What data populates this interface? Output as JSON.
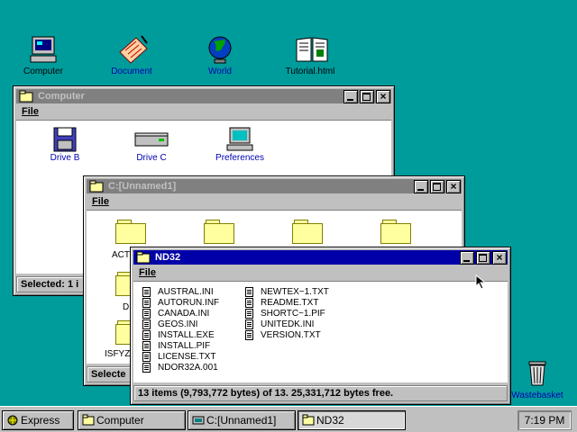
{
  "desktop": {
    "icons": [
      {
        "label": "Computer"
      },
      {
        "label": "Document"
      },
      {
        "label": "World"
      },
      {
        "label": "Tutorial.html"
      }
    ],
    "wastebasket": {
      "label": "Wastebasket"
    }
  },
  "windows": {
    "computer": {
      "title": "Computer",
      "menu": "File",
      "items": [
        {
          "label": "Drive B"
        },
        {
          "label": "Drive C"
        },
        {
          "label": "Preferences"
        }
      ],
      "status": "Selected: 1 i"
    },
    "unnamed": {
      "title": "C:[Unnamed1]",
      "menu": "File",
      "folders": [
        {
          "label": "ACT"
        },
        {
          "label": ""
        },
        {
          "label": ""
        },
        {
          "label": ""
        },
        {
          "label": "D"
        },
        {
          "label": "ISFYZC"
        }
      ],
      "status": "Selecte"
    },
    "nd32": {
      "title": "ND32",
      "menu": "File",
      "files_col1": [
        "AUSTRAL.INI",
        "AUTORUN.INF",
        "CANADA.INI",
        "GEOS.INI",
        "INSTALL.EXE",
        "INSTALL.PIF",
        "LICENSE.TXT",
        "NDOR32A.001"
      ],
      "files_col2": [
        "NEWTEX~1.TXT",
        "README.TXT",
        "SHORTC~1.PIF",
        "UNITEDK.INI",
        "VERSION.TXT"
      ],
      "status": "13 items (9,793,772 bytes) of 13.  25,331,712 bytes free."
    }
  },
  "taskbar": {
    "start_label": "Express",
    "buttons": [
      {
        "label": "Computer"
      },
      {
        "label": "C:[Unnamed1]"
      },
      {
        "label": "ND32"
      }
    ],
    "clock": "7:19 PM"
  },
  "colors": {
    "desktop": "#009C9C",
    "active_title": "#0000A8",
    "inactive_title": "#808080",
    "folder": "#FFFFA0"
  }
}
